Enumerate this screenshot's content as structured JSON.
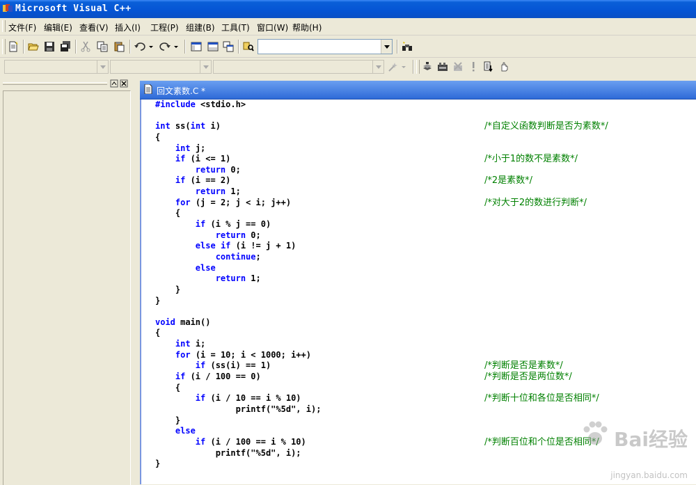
{
  "window": {
    "title": "Microsoft Visual C++",
    "icon": "vc-app-icon"
  },
  "menu": [
    {
      "label": "文件(F)"
    },
    {
      "label": "编辑(E)"
    },
    {
      "label": "查看(V)"
    },
    {
      "label": "插入(I)"
    },
    {
      "label": "工程(P)"
    },
    {
      "label": "组建(B)"
    },
    {
      "label": "工具(T)"
    },
    {
      "label": "窗口(W)"
    },
    {
      "label": "帮助(H)"
    }
  ],
  "toolbar": {
    "find_combo_value": "",
    "class_combo_value": "",
    "member_combo_value": "",
    "function_combo_value": ""
  },
  "editor": {
    "tab_title": "回文素数.C *",
    "lines": [
      {
        "code": "#include <stdio.h>",
        "comment": ""
      },
      {
        "code": "",
        "comment": ""
      },
      {
        "code": "int ss(int i)",
        "comment": "/*自定义函数判断是否为素数*/"
      },
      {
        "code": "{",
        "comment": ""
      },
      {
        "code": "    int j;",
        "comment": ""
      },
      {
        "code": "    if (i <= 1)",
        "comment": "/*小于1的数不是素数*/"
      },
      {
        "code": "        return 0;",
        "comment": ""
      },
      {
        "code": "    if (i == 2)",
        "comment": "/*2是素数*/"
      },
      {
        "code": "        return 1;",
        "comment": ""
      },
      {
        "code": "    for (j = 2; j < i; j++)",
        "comment": "/*对大于2的数进行判断*/"
      },
      {
        "code": "    {",
        "comment": ""
      },
      {
        "code": "        if (i % j == 0)",
        "comment": ""
      },
      {
        "code": "            return 0;",
        "comment": ""
      },
      {
        "code": "        else if (i != j + 1)",
        "comment": ""
      },
      {
        "code": "            continue;",
        "comment": ""
      },
      {
        "code": "        else",
        "comment": ""
      },
      {
        "code": "            return 1;",
        "comment": ""
      },
      {
        "code": "    }",
        "comment": ""
      },
      {
        "code": "}",
        "comment": ""
      },
      {
        "code": "",
        "comment": ""
      },
      {
        "code": "void main()",
        "comment": ""
      },
      {
        "code": "{",
        "comment": ""
      },
      {
        "code": "    int i;",
        "comment": ""
      },
      {
        "code": "    for (i = 10; i < 1000; i++)",
        "comment": ""
      },
      {
        "code": "        if (ss(i) == 1)",
        "comment": "/*判断是否是素数*/"
      },
      {
        "code": "    if (i / 100 == 0)",
        "comment": "/*判断是否是两位数*/"
      },
      {
        "code": "    {",
        "comment": ""
      },
      {
        "code": "        if (i / 10 == i % 10)",
        "comment": "/*判断十位和各位是否相同*/"
      },
      {
        "code": "                printf(\"%5d\", i);",
        "comment": ""
      },
      {
        "code": "    }",
        "comment": ""
      },
      {
        "code": "    else",
        "comment": ""
      },
      {
        "code": "        if (i / 100 == i % 10)",
        "comment": "/*判断百位和个位是否相同*/"
      },
      {
        "code": "            printf(\"%5d\", i);",
        "comment": ""
      },
      {
        "code": "}",
        "comment": ""
      }
    ]
  },
  "watermark": {
    "text": "Bai经验",
    "url": "jingyan.baidu.com"
  },
  "colors": {
    "keyword": "#0000ff",
    "comment": "#008000",
    "titlebar": "#0554d4"
  }
}
